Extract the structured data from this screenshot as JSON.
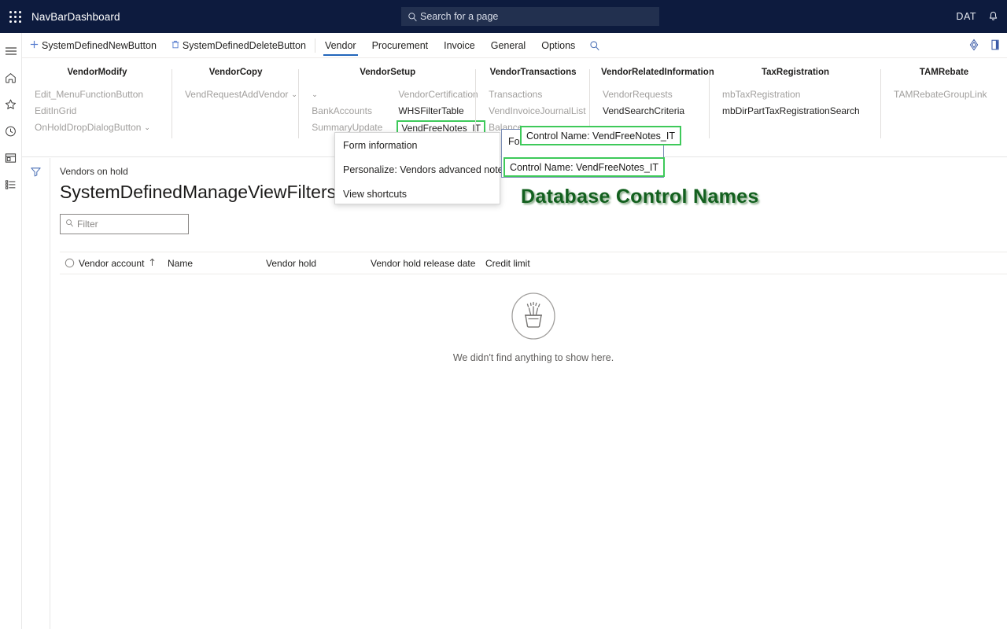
{
  "topbar": {
    "app_title": "NavBarDashboard",
    "search_placeholder": "Search for a page",
    "search_icon": "search-icon",
    "waffle_icon": "app-launcher-icon",
    "user_initials": "DAT",
    "bell_icon": "notifications-bell-icon"
  },
  "rail": {
    "items": [
      {
        "icon": "hamburger-menu-icon",
        "name": "navigation-toggle"
      },
      {
        "icon": "home-icon",
        "name": "home"
      },
      {
        "icon": "star-icon",
        "name": "favorites"
      },
      {
        "icon": "clock-icon",
        "name": "recent"
      },
      {
        "icon": "workspace-icon",
        "name": "workspaces"
      },
      {
        "icon": "list-icon",
        "name": "modules"
      }
    ]
  },
  "action_pane": {
    "new_button": "SystemDefinedNewButton",
    "new_icon": "plus-icon",
    "delete_button": "SystemDefinedDeleteButton",
    "delete_icon": "trash-icon",
    "tabs": [
      {
        "label": "Vendor",
        "active": true
      },
      {
        "label": "Procurement",
        "active": false
      },
      {
        "label": "Invoice",
        "active": false
      },
      {
        "label": "General",
        "active": false
      },
      {
        "label": "Options",
        "active": false
      }
    ],
    "tab_search_icon": "search-icon",
    "right_icons": [
      {
        "icon": "gem-diamond-icon",
        "name": "personalize-icon"
      },
      {
        "icon": "panel-collapse-icon",
        "name": "collapse-pane-icon"
      }
    ]
  },
  "ribbon": {
    "groups": [
      {
        "title": "VendorModify",
        "columns": [
          {
            "commands": [
              {
                "label": "Edit_MenuFunctionButton",
                "enabled": false,
                "caret": false,
                "highlight": false
              },
              {
                "label": "EditInGrid",
                "enabled": false,
                "caret": false,
                "highlight": false
              },
              {
                "label": "OnHoldDropDialogButton",
                "enabled": false,
                "caret": true,
                "highlight": false
              }
            ]
          }
        ]
      },
      {
        "title": "VendorCopy",
        "columns": [
          {
            "commands": [
              {
                "label": "VendRequestAddVendor",
                "enabled": false,
                "caret": true,
                "highlight": false
              }
            ]
          }
        ]
      },
      {
        "title": "VendorSetup",
        "columns": [
          {
            "commands": [
              {
                "label": "",
                "enabled": false,
                "caret": true,
                "highlight": false
              },
              {
                "label": "BankAccounts",
                "enabled": false,
                "caret": false,
                "highlight": false
              },
              {
                "label": "SummaryUpdate",
                "enabled": false,
                "caret": false,
                "highlight": false
              }
            ]
          },
          {
            "commands": [
              {
                "label": "VendorCertification",
                "enabled": false,
                "caret": false,
                "highlight": false
              },
              {
                "label": "WHSFilterTable",
                "enabled": true,
                "caret": false,
                "highlight": false
              },
              {
                "label": "VendFreeNotes_IT",
                "enabled": true,
                "caret": false,
                "highlight": true
              }
            ]
          }
        ]
      },
      {
        "title": "VendorTransactions",
        "columns": [
          {
            "commands": [
              {
                "label": "Transactions",
                "enabled": false,
                "caret": false,
                "highlight": false
              },
              {
                "label": "VendInvoiceJournalList",
                "enabled": false,
                "caret": false,
                "highlight": false
              },
              {
                "label": "Balance",
                "enabled": false,
                "caret": false,
                "highlight": false
              }
            ]
          }
        ]
      },
      {
        "title": "VendorRelatedInformation",
        "columns": [
          {
            "commands": [
              {
                "label": "VendorRequests",
                "enabled": false,
                "caret": false,
                "highlight": false
              },
              {
                "label": "VendSearchCriteria",
                "enabled": true,
                "caret": false,
                "highlight": false
              }
            ]
          }
        ]
      },
      {
        "title": "TaxRegistration",
        "columns": [
          {
            "commands": [
              {
                "label": "mbTaxRegistration",
                "enabled": false,
                "caret": false,
                "highlight": false
              },
              {
                "label": "mbDirPartTaxRegistrationSearch",
                "enabled": true,
                "caret": false,
                "highlight": false
              }
            ]
          }
        ]
      },
      {
        "title": "TAMRebate",
        "columns": [
          {
            "commands": [
              {
                "label": "TAMRebateGroupLink",
                "enabled": false,
                "caret": false,
                "highlight": false
              }
            ]
          }
        ]
      }
    ]
  },
  "context_menu": {
    "items": [
      "Form information",
      "Personalize: Vendors advanced notes setup",
      "View shortcuts"
    ]
  },
  "ghost_panel": {
    "text": "Form"
  },
  "tooltips": {
    "tip_upper": "Control Name: VendFreeNotes_IT",
    "tip_lower": "Control Name: VendFreeNotes_IT"
  },
  "annotation": {
    "text": "Database Control Names",
    "color": "#13601f"
  },
  "page": {
    "breadcrumb": "Vendors on hold",
    "title": "SystemDefinedManageViewFilters",
    "title_caret": "⌄",
    "filter_placeholder": "Filter",
    "filter_icon": "search-icon",
    "filter_rail_icon": "filter-funnel-icon"
  },
  "grid": {
    "select_all_icon": "select-all-circle-icon",
    "sort_icon": "sort-ascending-arrow-icon",
    "columns": [
      "Vendor account",
      "Name",
      "Vendor hold",
      "Vendor hold release date",
      "Credit limit"
    ],
    "rows": [],
    "empty_state": {
      "icon": "empty-plant-pot-icon",
      "message": "We didn't find anything to show here."
    }
  }
}
